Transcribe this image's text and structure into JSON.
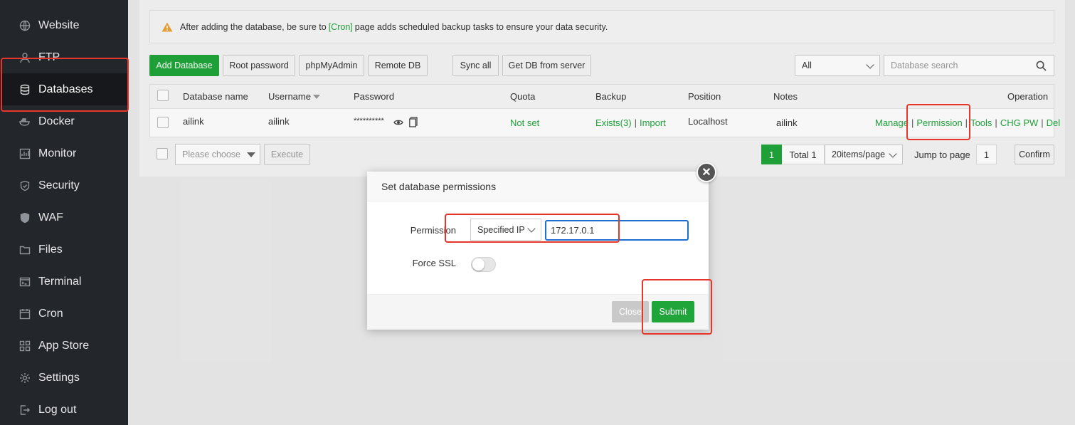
{
  "sidebar": {
    "items": [
      {
        "label": "Website",
        "icon": "globe-icon"
      },
      {
        "label": "FTP",
        "icon": "user-icon"
      },
      {
        "label": "Databases",
        "icon": "database-icon",
        "active": true
      },
      {
        "label": "Docker",
        "icon": "docker-icon"
      },
      {
        "label": "Monitor",
        "icon": "monitor-icon"
      },
      {
        "label": "Security",
        "icon": "shield-icon"
      },
      {
        "label": "WAF",
        "icon": "waf-shield-icon"
      },
      {
        "label": "Files",
        "icon": "folder-icon"
      },
      {
        "label": "Terminal",
        "icon": "terminal-icon"
      },
      {
        "label": "Cron",
        "icon": "calendar-icon"
      },
      {
        "label": "App Store",
        "icon": "grid-icon"
      },
      {
        "label": "Settings",
        "icon": "gear-icon"
      },
      {
        "label": "Log out",
        "icon": "logout-icon"
      }
    ]
  },
  "alert": {
    "prefix": "After adding the database, be sure to",
    "link": "[Cron]",
    "suffix": "page adds scheduled backup tasks to ensure your data security."
  },
  "toolbar": {
    "add_database": "Add Database",
    "root_password": "Root password",
    "phpmyadmin": "phpMyAdmin",
    "remote_db": "Remote DB",
    "sync_all": "Sync all",
    "get_db_from_server": "Get DB from server",
    "filter_value": "All",
    "search_placeholder": "Database search"
  },
  "table": {
    "headers": {
      "name": "Database name",
      "username": "Username",
      "password": "Password",
      "quota": "Quota",
      "backup": "Backup",
      "position": "Position",
      "notes": "Notes",
      "operation": "Operation"
    },
    "rows": [
      {
        "name": "ailink",
        "username": "ailink",
        "password": "**********",
        "quota": "Not set",
        "backup_exists": "Exists(3)",
        "backup_import": "Import",
        "position": "Localhost",
        "notes": "ailink",
        "ops": {
          "manage": "Manage",
          "permission": "Permission",
          "tools": "Tools",
          "chg_pw": "CHG PW",
          "del": "Del"
        }
      }
    ]
  },
  "footer": {
    "batch_placeholder": "Please choose",
    "execute": "Execute",
    "current_page": "1",
    "total": "Total 1",
    "per_page": "20items/page",
    "jump_label": "Jump to page",
    "jump_value": "1",
    "confirm": "Confirm"
  },
  "modal": {
    "title": "Set database permissions",
    "permission_label": "Permission",
    "permission_select": "Specified IP",
    "ip_value": "172.17.0.1",
    "force_ssl_label": "Force SSL",
    "force_ssl_on": false,
    "close": "Close",
    "submit": "Submit"
  },
  "colors": {
    "accent": "#20a53a",
    "sidebar_bg": "#23262b",
    "highlight": "#e8352a",
    "input_focus": "#1f6fd1"
  }
}
